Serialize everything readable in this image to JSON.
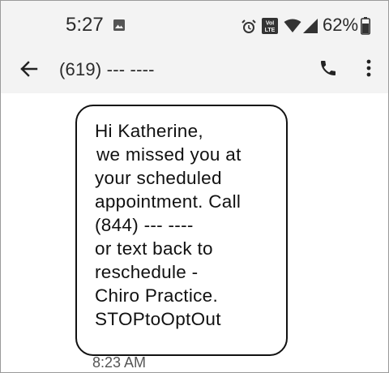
{
  "status_bar": {
    "time": "5:27",
    "battery": "62%",
    "icons": [
      "gallery-icon",
      "alarm-icon",
      "volte-icon",
      "wifi-icon",
      "signal-icon",
      "battery-icon"
    ]
  },
  "app_bar": {
    "contact": "(619) --- ----",
    "icons": [
      "back-arrow-icon",
      "phone-icon",
      "more-vert-icon"
    ]
  },
  "message": {
    "lines": [
      "Hi Katherine,",
      "we missed you at",
      "your scheduled",
      "appointment. Call",
      "(844) --- ----",
      "or text back to",
      "reschedule -",
      "Chiro Practice.",
      "STOPtoOptOut"
    ],
    "timestamp": "8:23 AM"
  },
  "colors": {
    "bar_bg": "#f3f3f3",
    "thread_bg": "#ffffff",
    "bubble_border": "#111111",
    "timestamp": "#555555"
  }
}
